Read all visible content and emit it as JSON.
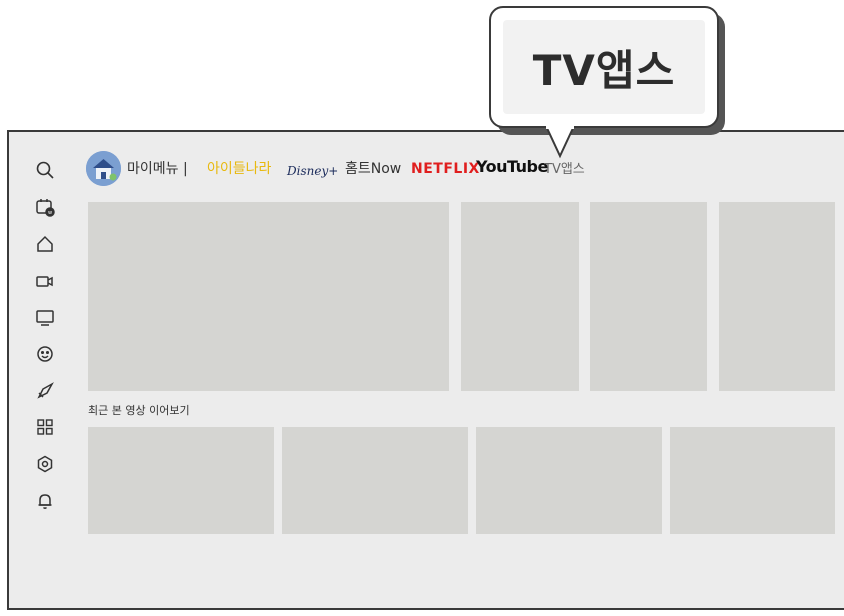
{
  "callout": {
    "text": "TV앱스"
  },
  "sidebar": {
    "icons": [
      "search-icon",
      "calendar-icon",
      "home-icon",
      "camera-icon",
      "monitor-icon",
      "smiley-icon",
      "rocket-icon",
      "grid-icon",
      "settings-icon",
      "bell-icon"
    ]
  },
  "menu": {
    "my_menu": "마이메뉴 |",
    "kids": "아이들나라",
    "disney": "Disney+",
    "home_training": "홈트Now",
    "netflix": "NETFLIX",
    "youtube": "YouTube",
    "tv_apps": "TV앱스"
  },
  "section": {
    "continue_watching": "최근 본 영상 이어보기"
  },
  "colors": {
    "tile": "#d5d5d2",
    "background": "#ececec",
    "kids": "#e8b90f",
    "netflix": "#e01e1e"
  }
}
